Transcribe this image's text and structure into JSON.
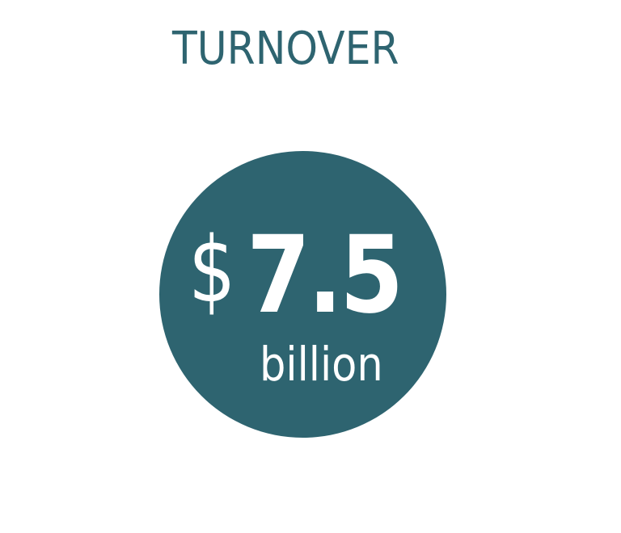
{
  "title": "TURNOVER",
  "stat": {
    "currency": "$",
    "value": "7.5",
    "unit": "billion"
  },
  "colors": {
    "accent": "#2e6470",
    "background": "#ffffff",
    "stat_text": "#ffffff"
  }
}
